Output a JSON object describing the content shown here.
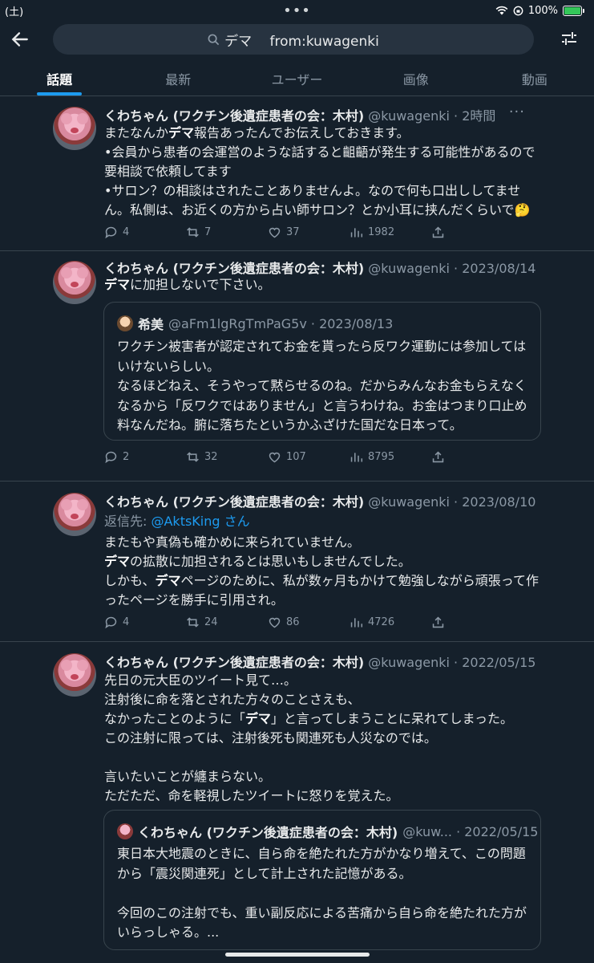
{
  "status": {
    "day": "(土)",
    "battery": "100%",
    "battery_level": 1.0
  },
  "search": {
    "query": "デマ　 from:kuwagenki"
  },
  "tabs": [
    {
      "label": "話題",
      "active": true
    },
    {
      "label": "最新"
    },
    {
      "label": "ユーザー"
    },
    {
      "label": "画像"
    },
    {
      "label": "動画"
    }
  ],
  "tweets": [
    {
      "name": "くわちゃん (ワクチン後遺症患者の会：木村)",
      "meta": "@kuwagenki · 2時間",
      "body": "またなんか%%デマ%%報告あったんでお伝えしておきます。\n•会員から患者の会運営のような話すると齟齬が発生する可能性があるので要相談で依頼してます\n•サロン？の相談はされたことありませんよ。なので何も口出ししてません。私側は、お近くの方から占い師サロン？とか小耳に挟んだくらいで🤔",
      "replies": "4",
      "retweets": "7",
      "likes": "37",
      "views": "1982"
    },
    {
      "name": "くわちゃん (ワクチン後遺症患者の会：木村)",
      "meta": "@kuwagenki · 2023/08/14",
      "body": "%%デマ%%に加担しないで下さい。",
      "quote": {
        "name": "希美",
        "meta": "@aFm1lgRgTmPaG5v · 2023/08/13",
        "text": "ワクチン被害者が認定されてお金を貰ったら反ワク運動には参加してはいけないらしい。\nなるほどねえ、そうやって黙らせるのね。だからみんなお金もらえなくなるから「反ワクではありません」と言うわけね。お金はつまり口止め料なんだね。腑に落ちたというかふざけた国だな日本って。"
      },
      "replies": "2",
      "retweets": "32",
      "likes": "107",
      "views": "8795"
    },
    {
      "name": "くわちゃん (ワクチン後遺症患者の会：木村)",
      "meta": "@kuwagenki · 2023/08/10",
      "reply_prefix": "返信先: ",
      "reply_handle": "@AktsKing さん",
      "body": "またもや真偽も確かめに来られていません。\n%%デマ%%の拡散に加担されるとは思いもしませんでした。\nしかも、%%デマ%%ページのために、私が数ヶ月もかけて勉強しながら頑張って作ったページを勝手に引用され。",
      "replies": "4",
      "retweets": "24",
      "likes": "86",
      "views": "4726"
    },
    {
      "name": "くわちゃん (ワクチン後遺症患者の会：木村)",
      "meta": "@kuwagenki · 2022/05/15",
      "body": "先日の元大臣のツイート見て…。\n注射後に命を落とされた方々のことさえも、\nなかったことのように「%%デマ%%」と言ってしまうことに呆れてしまった。\nこの注射に限っては、注射後死も関連死も人災なのでは。\n\n言いたいことが纏まらない。\nただただ、命を軽視したツイートに怒りを覚えた。",
      "quote": {
        "name": "くわちゃん (ワクチン後遺症患者の会：木村)",
        "meta": "@kuw... · 2022/05/15",
        "text": "東日本大地震のときに、自ら命を絶たれた方がかなり増えて、この問題から「震災関連死」として計上された記憶がある。\n\n今回のこの注射でも、重い副反応による苦痛から自ら命を絶たれた方がいらっしゃる。..."
      }
    }
  ]
}
